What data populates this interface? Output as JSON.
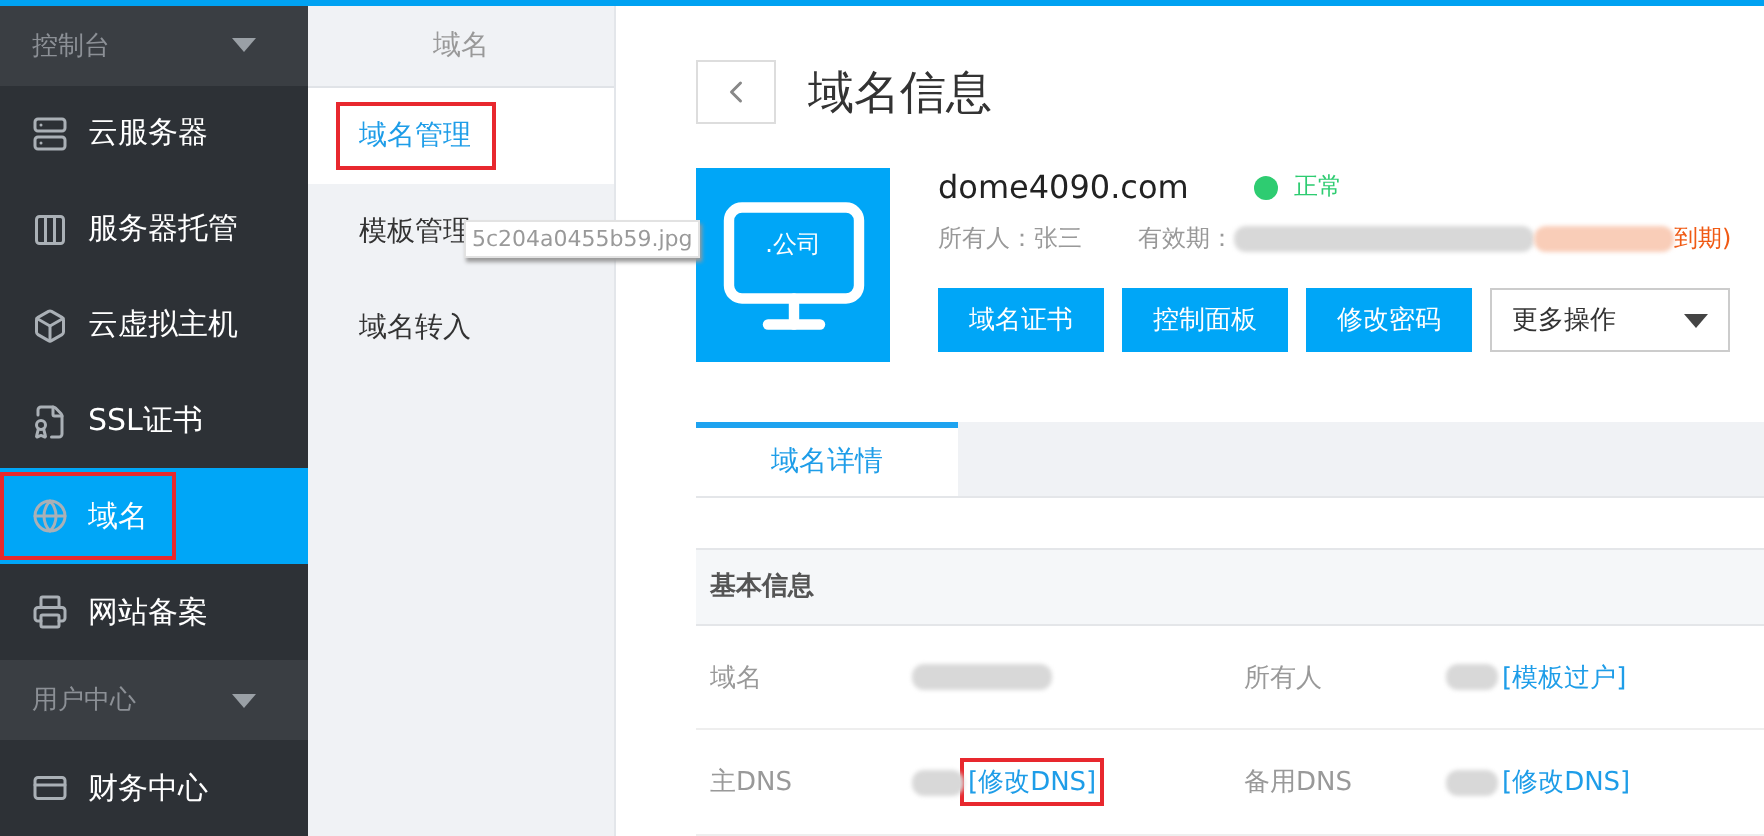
{
  "sidebar": {
    "sections": [
      {
        "title": "控制台",
        "expanded": true,
        "items": [
          {
            "label": "云服务器",
            "selected": false,
            "highlighted": false
          },
          {
            "label": "服务器托管",
            "selected": false,
            "highlighted": false
          },
          {
            "label": "云虚拟主机",
            "selected": false,
            "highlighted": false
          },
          {
            "label": "SSL证书",
            "selected": false,
            "highlighted": false
          },
          {
            "label": "域名",
            "selected": true,
            "highlighted": true
          },
          {
            "label": "网站备案",
            "selected": false,
            "highlighted": false
          }
        ]
      },
      {
        "title": "用户中心",
        "expanded": true,
        "items": [
          {
            "label": "财务中心",
            "selected": false,
            "highlighted": false
          }
        ]
      }
    ]
  },
  "subnav": {
    "title": "域名",
    "items": [
      {
        "label": "域名管理",
        "selected": true,
        "highlighted": true
      },
      {
        "label": "模板管理",
        "selected": false,
        "highlighted": false
      },
      {
        "label": "域名转入",
        "selected": false,
        "highlighted": false
      }
    ],
    "tooltip": "5c204a0455b59.jpg"
  },
  "page": {
    "title": "域名信息",
    "logo_text": ".公司",
    "domain": "dome4090.com",
    "status": {
      "label": "正常",
      "color": "#2ecc71"
    },
    "owner": "所有人：张三",
    "expiry_label": "有效期：",
    "expiry_suffix": "到期)",
    "buttons": [
      "域名证书",
      "控制面板",
      "修改密码"
    ],
    "more_dropdown": "更多操作",
    "tabs": [
      {
        "label": "域名详情",
        "selected": true
      }
    ],
    "section_title": "基本信息",
    "rows": [
      [
        {
          "label": "域名"
        },
        {
          "label": "所有人",
          "link": "[模板过户]",
          "highlighted": false
        }
      ],
      [
        {
          "label": "主DNS",
          "link": "[修改DNS]",
          "highlighted": true
        },
        {
          "label": "备用DNS",
          "link": "[修改DNS]",
          "highlighted": false
        }
      ]
    ]
  }
}
